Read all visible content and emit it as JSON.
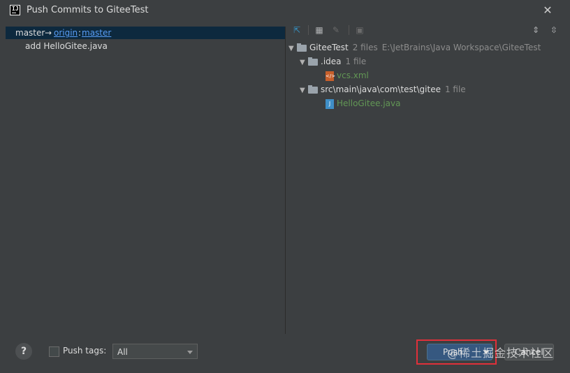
{
  "window": {
    "title": "Push Commits to GiteeTest"
  },
  "commits": {
    "branch": "master",
    "arrow": "→",
    "remote": "origin",
    "separator": ":",
    "remote_branch": "master",
    "items": [
      "add HelloGitee.java"
    ]
  },
  "tree": {
    "root": {
      "name": "GiteeTest",
      "meta": "2 files",
      "path": "E:\\JetBrains\\Java Workspace\\GiteeTest"
    },
    "idea": {
      "name": ".idea",
      "meta": "1 file"
    },
    "vcs": {
      "name": "vcs.xml"
    },
    "src": {
      "name": "src\\main\\java\\com\\test\\gitee",
      "meta": "1 file"
    },
    "hello": {
      "name": "HelloGitee.java"
    }
  },
  "footer": {
    "help_label": "?",
    "push_tags_label": "Push tags:",
    "tags_select_value": "All",
    "push_label": "Push",
    "cancel_label": "Cancel",
    "watermark": "@稀土掘金技术社区"
  },
  "colors": {
    "selection": "#0d293e",
    "link": "#589df6",
    "accent": "#365880",
    "highlight": "#e0303a",
    "added_file": "#629755"
  }
}
